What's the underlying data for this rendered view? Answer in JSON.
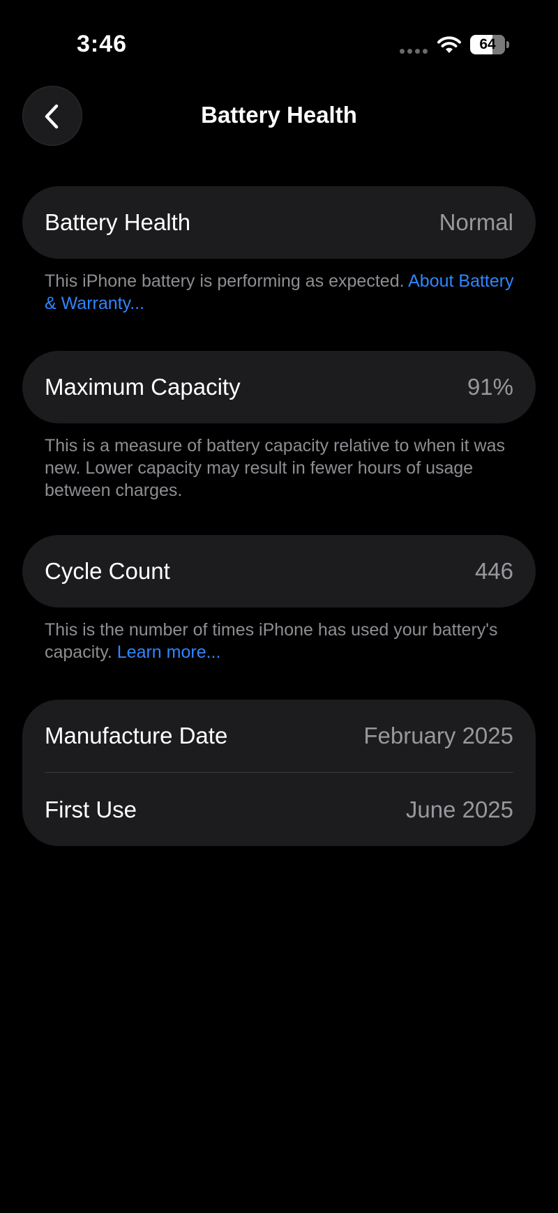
{
  "status_bar": {
    "time": "3:46",
    "battery_level": "64",
    "battery_fraction": 0.64
  },
  "icons": {
    "back": "chevron-left-icon",
    "wifi": "wifi-icon",
    "battery": "battery-icon",
    "signal": "cellular-signal-icon"
  },
  "colors": {
    "background": "#000000",
    "card": "#1c1c1e",
    "secondary_text": "#8e8e93",
    "link": "#2f86ff"
  },
  "header": {
    "title": "Battery Health"
  },
  "battery_health": {
    "label": "Battery Health",
    "value": "Normal",
    "description": "This iPhone battery is performing as expected.",
    "link": "About Battery & Warranty..."
  },
  "maximum_capacity": {
    "label": "Maximum Capacity",
    "value": "91%",
    "description": "This is a measure of battery capacity relative to when it was new. Lower capacity may result in fewer hours of usage between charges."
  },
  "cycle_count": {
    "label": "Cycle Count",
    "value": "446",
    "description": "This is the number of times iPhone has used your battery's capacity.",
    "link": "Learn more..."
  },
  "dates": {
    "manufacture_label": "Manufacture Date",
    "manufacture_value": "February 2025",
    "first_use_label": "First Use",
    "first_use_value": "June 2025"
  }
}
